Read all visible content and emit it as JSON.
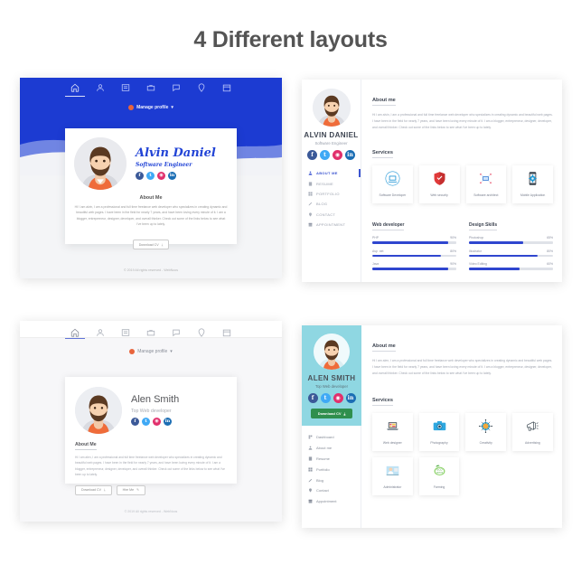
{
  "page": {
    "title": "4 Different layouts"
  },
  "layout1": {
    "nav_icons": [
      "home-icon",
      "user-icon",
      "list-icon",
      "briefcase-icon",
      "chat-icon",
      "pin-icon",
      "calendar-icon"
    ],
    "manage_label": "Manage profile",
    "name": "Alvin Daniel",
    "role": "Software Engineer",
    "socials": [
      "facebook-icon",
      "twitter-icon",
      "instagram-icon",
      "linkedin-icon"
    ],
    "about_heading": "About Me",
    "about_text": "Hi! I am alvin, I am a professional and full time freelance web developer who specializes in creating dynamic and beautiful web pages. I have been in the field for nearly 7 years, and have been loving every minute of it. I am a blogger, entrepreneur, designer, developer, and overall thinker. Check out some of the links below to see what I've been up to lately.",
    "download_label": "Download CV",
    "footer": "© 2019 All rights reserved - WebNoos"
  },
  "layout2": {
    "name": "ALVIN DANIEL",
    "role": "Software Engineer",
    "socials": [
      "facebook-icon",
      "twitter-icon",
      "instagram-icon",
      "linkedin-icon"
    ],
    "menu": [
      {
        "label": "ABOUT ME",
        "icon": "user-icon",
        "active": true
      },
      {
        "label": "RESUME",
        "icon": "file-icon",
        "active": false
      },
      {
        "label": "PORTFOLIO",
        "icon": "grid-icon",
        "active": false
      },
      {
        "label": "BLOG",
        "icon": "pencil-icon",
        "active": false
      },
      {
        "label": "CONTACT",
        "icon": "pin-icon",
        "active": false
      },
      {
        "label": "APPOINTMENT",
        "icon": "calendar-icon",
        "active": false
      }
    ],
    "about_heading": "About me",
    "about_text": "Hi I am alvin, I am a professional and full time freelance web developer who specializes in creating dynamic and beautiful web pages. I have been in the field for nearly 7 years, and have been loving every minute of it. I am a blogger, entrepreneur, designer, developer, and overall thinker. Check out some of the links below to see what I've been up to lately.",
    "services_heading": "Services",
    "services": [
      {
        "label": "Software Developer",
        "icon": "laptop-icon"
      },
      {
        "label": "Web security",
        "icon": "shield-icon"
      },
      {
        "label": "Software architect",
        "icon": "network-icon"
      },
      {
        "label": "Mobile Application",
        "icon": "mobile-gear-icon"
      }
    ],
    "skill_groups": [
      {
        "title": "Web developer",
        "skills": [
          {
            "label": "PHP",
            "value": "90%",
            "pct": 90
          },
          {
            "label": "Asp .net",
            "value": "80%",
            "pct": 82
          },
          {
            "label": "Java",
            "value": "90%",
            "pct": 90
          }
        ]
      },
      {
        "title": "Design Skills",
        "skills": [
          {
            "label": "Photoshop",
            "value": "65%",
            "pct": 65
          },
          {
            "label": "Illustrator",
            "value": "80%",
            "pct": 82
          },
          {
            "label": "Video Editing",
            "value": "60%",
            "pct": 60
          }
        ]
      }
    ]
  },
  "layout3": {
    "nav_icons": [
      "home-icon",
      "user-icon",
      "list-icon",
      "briefcase-icon",
      "chat-icon",
      "pin-icon",
      "calendar-icon"
    ],
    "manage_label": "Manage profile",
    "name": "Alen Smith",
    "role": "Top Web developer",
    "socials": [
      "facebook-icon",
      "twitter-icon",
      "instagram-icon",
      "linkedin-icon"
    ],
    "about_heading": "About Me",
    "about_text": "Hi I am alen, I am a professional and full time freelance web developer who specializes in creating dynamic and beautiful web pages. I have been in the field for nearly 7 years, and have been loving every minute of it. I am a blogger, entrepreneur, designer, developer, and overall thinker. Check out some of the links below to see what I've been up to lately.",
    "buttons": [
      "Download CV",
      "Hire Me"
    ],
    "footer": "© 2019 All rights reserved - WebNoos"
  },
  "layout4": {
    "name": "ALEN SMITH",
    "role": "Top Web developer",
    "socials": [
      "facebook-icon",
      "twitter-icon",
      "instagram-icon",
      "linkedin-icon"
    ],
    "download_label": "Download CV",
    "menu": [
      {
        "label": "Dashboard",
        "icon": "dashboard-icon"
      },
      {
        "label": "About me",
        "icon": "user-icon"
      },
      {
        "label": "Resume",
        "icon": "file-icon"
      },
      {
        "label": "Portfolio",
        "icon": "grid-icon"
      },
      {
        "label": "Blog",
        "icon": "pencil-icon"
      },
      {
        "label": "Contact",
        "icon": "pin-icon"
      },
      {
        "label": "Appointment",
        "icon": "calendar-icon"
      }
    ],
    "about_heading": "About me",
    "about_text": "Hi I am alen, I am a professional and full time freelance web developer who specializes in creating dynamic and beautiful web pages. I have been in the field for nearly 7 years, and have been loving every minute of it. I am a blogger, entrepreneur, designer, developer, and overall thinker. Check out some of the links below to see what I've been up to lately.",
    "services_heading": "Services",
    "services": [
      {
        "label": "Web designer",
        "icon": "laptop-color-icon"
      },
      {
        "label": "Photography",
        "icon": "camera-icon"
      },
      {
        "label": "Creativity",
        "icon": "brain-icon"
      },
      {
        "label": "Advertising",
        "icon": "megaphone-icon"
      },
      {
        "label": "Administrator",
        "icon": "person-desk-icon"
      },
      {
        "label": "Farming",
        "icon": "farming-icon"
      }
    ]
  },
  "colors": {
    "hero_blue": "#1c3bd2",
    "wave_blue": "#7f93e6",
    "accent_blue": "#2f46cf",
    "sidebar_teal": "#8fd7e2",
    "download_green": "#2f8f4e",
    "facebook": "#3b5998",
    "twitter": "#3fa9f5",
    "instagram": "#e1306c",
    "linkedin": "#1c6eb4"
  }
}
